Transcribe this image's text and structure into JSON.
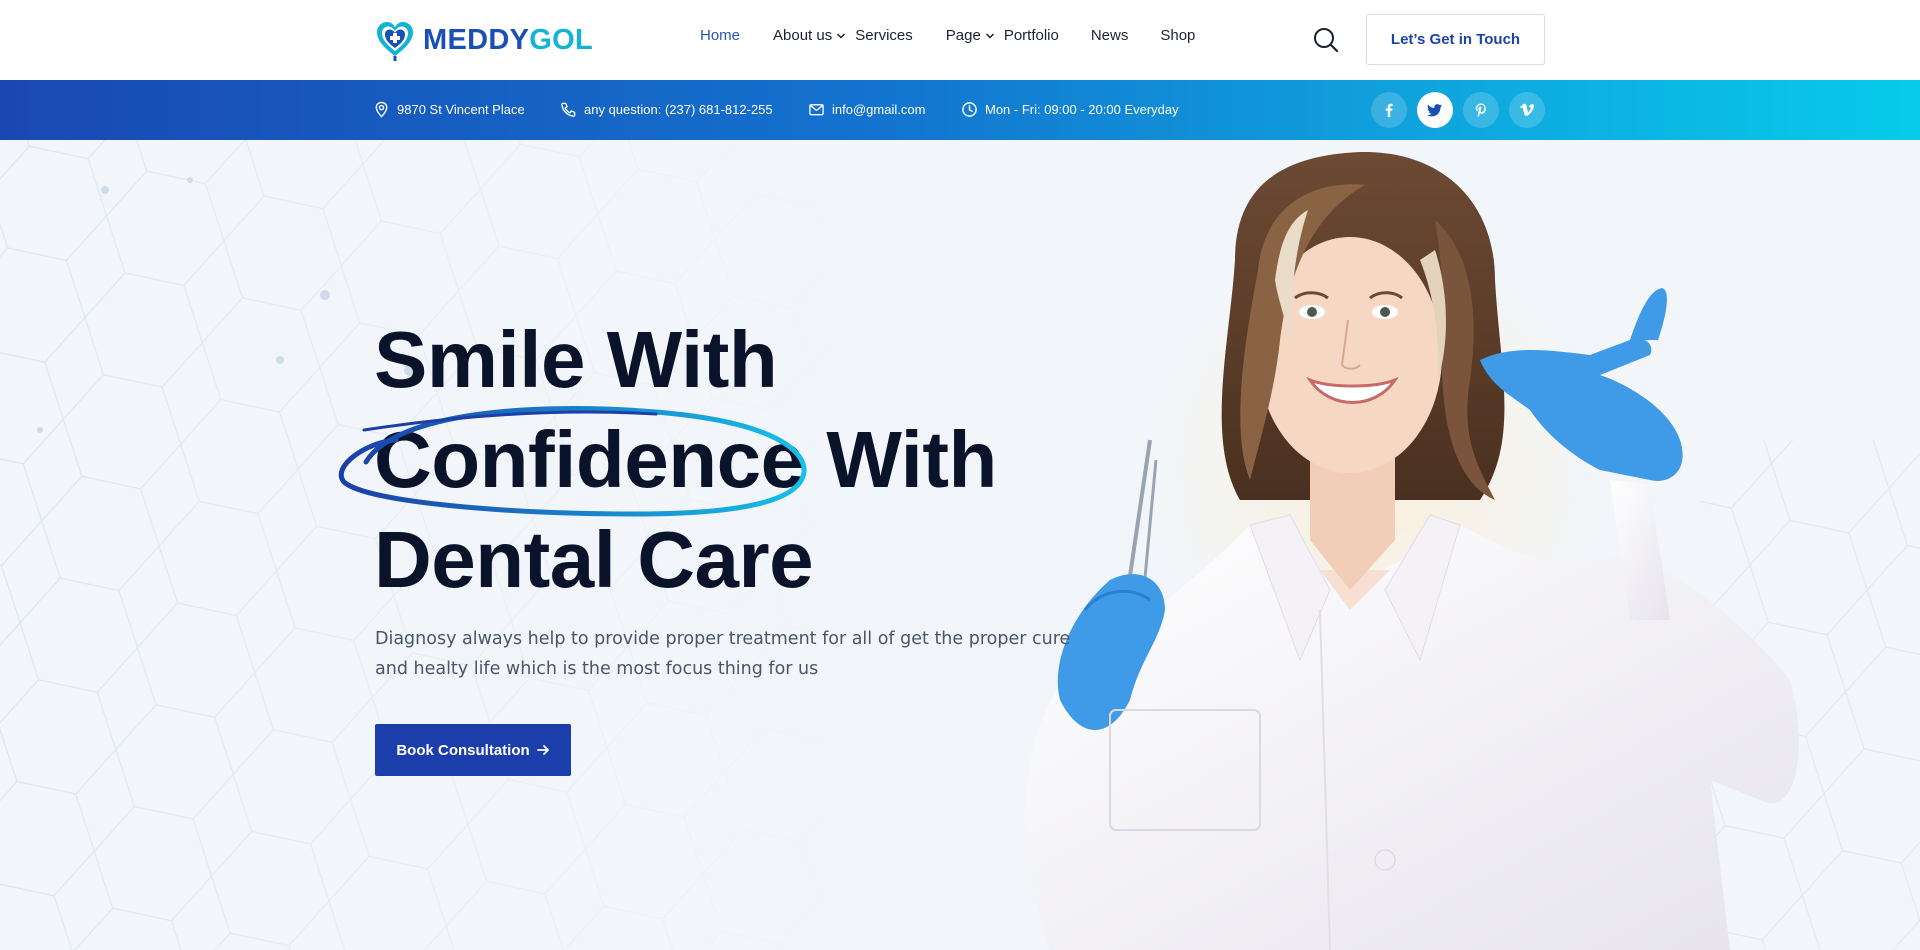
{
  "brand": {
    "name_a": "MEDDY",
    "name_b": "GOL"
  },
  "nav": {
    "items": [
      {
        "label": "Home",
        "active": true,
        "dropdown": false
      },
      {
        "label": "About us",
        "active": false,
        "dropdown": true
      },
      {
        "label": "Services",
        "active": false,
        "dropdown": false
      },
      {
        "label": "Page",
        "active": false,
        "dropdown": true
      },
      {
        "label": "Portfolio",
        "active": false,
        "dropdown": false
      },
      {
        "label": "News",
        "active": false,
        "dropdown": false
      },
      {
        "label": "Shop",
        "active": false,
        "dropdown": false
      }
    ],
    "search_icon": "search-icon",
    "cta_label": "Let’s Get in Touch"
  },
  "topbar": {
    "address": "9870 St Vincent Place",
    "phone": "any question: (237) 681-812-255",
    "email": "info@gmail.com",
    "hours": "Mon - Fri: 09:00 - 20:00 Everyday",
    "socials": [
      "facebook-icon",
      "twitter-icon",
      "pinterest-icon",
      "vimeo-icon"
    ],
    "active_social": "twitter-icon"
  },
  "hero": {
    "line1": "Smile With",
    "line2_highlight": "Confidence",
    "line2_rest": "With",
    "line3": "Dental Care",
    "description": "Diagnosy always help to provide proper treatment for all of get the proper cure and healty life which is the most focus thing for us",
    "button_label": "Book Consultation",
    "button_icon": "arrow-right-icon"
  },
  "colors": {
    "primary": "#1c3eaa",
    "accent": "#14b3d6",
    "heading": "#0a1329",
    "topbar_start": "#1a48b3",
    "topbar_end": "#08cbeb"
  }
}
